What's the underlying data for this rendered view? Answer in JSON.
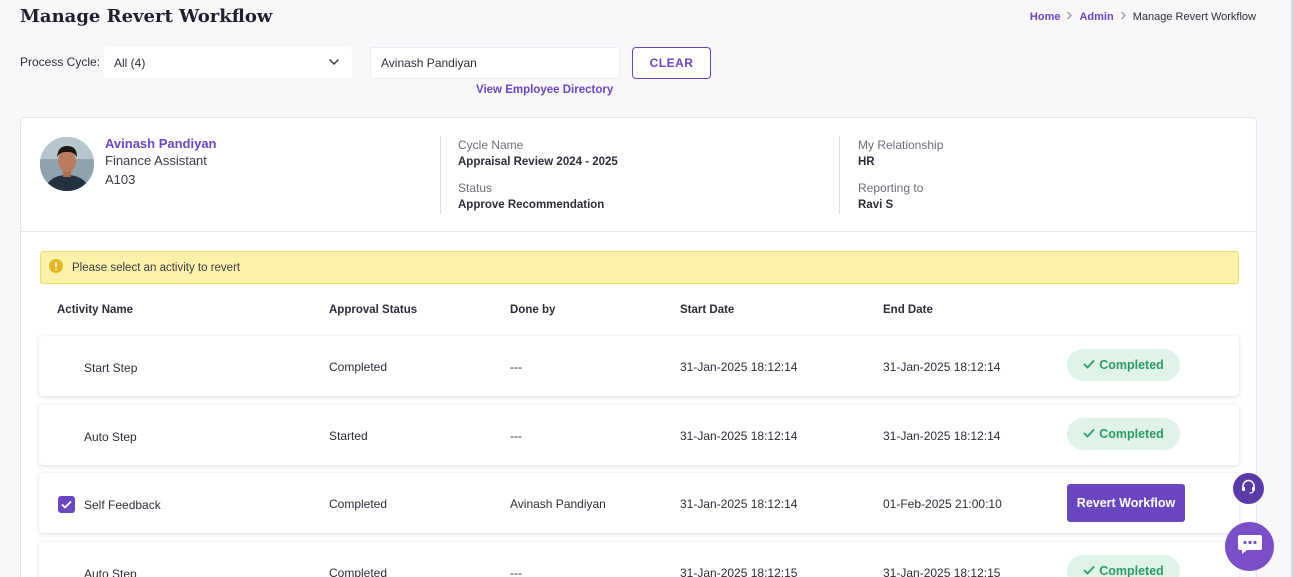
{
  "page": {
    "title": "Manage Revert Workflow"
  },
  "breadcrumb": {
    "home": "Home",
    "admin": "Admin",
    "current": "Manage Revert Workflow"
  },
  "filters": {
    "process_cycle_label": "Process Cycle:",
    "process_cycle_value": "All (4)",
    "employee_search_value": "Avinash Pandiyan",
    "clear_label": "CLEAR",
    "directory_link": "View Employee Directory"
  },
  "employee": {
    "name": "Avinash Pandiyan",
    "role": "Finance Assistant",
    "id": "A103",
    "cycle_name_label": "Cycle Name",
    "cycle_name": "Appraisal Review 2024 - 2025",
    "status_label": "Status",
    "status": "Approve Recommendation",
    "relationship_label": "My Relationship",
    "relationship": "HR",
    "reporting_label": "Reporting to",
    "reporting_to": "Ravi S"
  },
  "alert": {
    "message": "Please select an activity to revert"
  },
  "table": {
    "headers": {
      "activity": "Activity Name",
      "approval": "Approval Status",
      "done_by": "Done by",
      "start": "Start Date",
      "end": "End Date"
    },
    "rows": [
      {
        "activity": "Start Step",
        "approval": "Completed",
        "done_by": "---",
        "start": "31-Jan-2025 18:12:14",
        "end": "31-Jan-2025 18:12:14",
        "action": "Completed"
      },
      {
        "activity": "Auto Step",
        "approval": "Started",
        "done_by": "---",
        "start": "31-Jan-2025 18:12:14",
        "end": "31-Jan-2025 18:12:14",
        "action": "Completed"
      },
      {
        "activity": "Self Feedback",
        "approval": "Completed",
        "done_by": "Avinash Pandiyan",
        "start": "31-Jan-2025 18:12:14",
        "end": "01-Feb-2025 21:00:10",
        "action": "Revert Workflow",
        "selected": true
      },
      {
        "activity": "Auto Step",
        "approval": "Completed",
        "done_by": "---",
        "start": "31-Jan-2025 18:12:15",
        "end": "31-Jan-2025 18:12:15",
        "action": "Completed"
      }
    ]
  },
  "colors": {
    "accent": "#6b46c1",
    "success_bg": "#dff3e8",
    "success_text": "#2e9a64",
    "alert_bg": "#fbf1a9"
  },
  "icons": {
    "select": "chevron-down-icon",
    "breadcrumb_separator": "chevron-right-icon",
    "alert": "info-icon",
    "status": "check-icon",
    "selection": "checkbox-checked-icon",
    "support": "headset-icon",
    "chat": "chat-icon"
  }
}
